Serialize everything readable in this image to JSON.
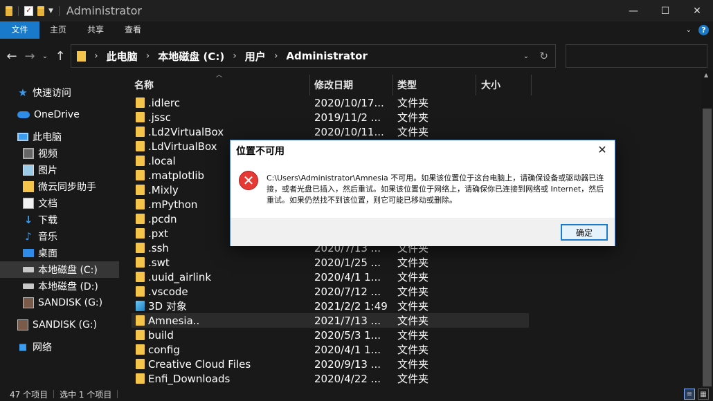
{
  "window": {
    "title": "Administrator",
    "controls": [
      "—",
      "☐",
      "✕"
    ]
  },
  "ribbon": {
    "tabs": [
      "文件",
      "主页",
      "共享",
      "查看"
    ]
  },
  "address": {
    "crumbs": [
      "此电脑",
      "本地磁盘 (C:)",
      "用户",
      "Administrator"
    ]
  },
  "nav": {
    "items": [
      {
        "label": "快速访问",
        "icon": "star-icon"
      },
      {
        "label": "OneDrive",
        "icon": "cloud-icon"
      },
      {
        "label": "此电脑",
        "icon": "pc-icon"
      },
      {
        "label": "视频",
        "icon": "video-icon"
      },
      {
        "label": "图片",
        "icon": "pictures-icon"
      },
      {
        "label": "微云同步助手",
        "icon": "weiyun-folder-icon"
      },
      {
        "label": "文档",
        "icon": "documents-icon"
      },
      {
        "label": "下载",
        "icon": "download-icon"
      },
      {
        "label": "音乐",
        "icon": "music-icon"
      },
      {
        "label": "桌面",
        "icon": "desktop-icon"
      },
      {
        "label": "本地磁盘 (C:)",
        "icon": "drive-icon"
      },
      {
        "label": "本地磁盘 (D:)",
        "icon": "drive-icon"
      },
      {
        "label": "SANDISK (G:)",
        "icon": "usb-drive-icon"
      },
      {
        "label": "SANDISK (G:)",
        "icon": "usb-drive-icon"
      },
      {
        "label": "网络",
        "icon": "network-icon"
      }
    ]
  },
  "columns": {
    "name": "名称",
    "date": "修改日期",
    "type": "类型",
    "size": "大小"
  },
  "files": [
    {
      "name": ".idlerc",
      "date": "2020/10/17...",
      "type": "文件夹"
    },
    {
      "name": ".jssc",
      "date": "2019/11/2 ...",
      "type": "文件夹"
    },
    {
      "name": ".Ld2VirtualBox",
      "date": "2020/10/11...",
      "type": "文件夹"
    },
    {
      "name": ".LdVirtualBox",
      "date": "",
      "type": ""
    },
    {
      "name": ".local",
      "date": "",
      "type": ""
    },
    {
      "name": ".matplotlib",
      "date": "",
      "type": ""
    },
    {
      "name": ".Mixly",
      "date": "",
      "type": ""
    },
    {
      "name": ".mPython",
      "date": "",
      "type": ""
    },
    {
      "name": ".pcdn",
      "date": "",
      "type": ""
    },
    {
      "name": ".pxt",
      "date": "",
      "type": ""
    },
    {
      "name": ".ssh",
      "date": "2020/7/13 ...",
      "type": "文件夹"
    },
    {
      "name": ".swt",
      "date": "2020/1/25 ...",
      "type": "文件夹"
    },
    {
      "name": ".uuid_airlink",
      "date": "2020/4/1 1...",
      "type": "文件夹"
    },
    {
      "name": ".vscode",
      "date": "2020/7/12 ...",
      "type": "文件夹"
    },
    {
      "name": "3D 对象",
      "date": "2021/2/2 1:49",
      "type": "文件夹"
    },
    {
      "name": "Amnesia..",
      "date": "2021/7/13 ...",
      "type": "文件夹"
    },
    {
      "name": "build",
      "date": "2020/5/3 1...",
      "type": "文件夹"
    },
    {
      "name": "config",
      "date": "2020/4/1 1...",
      "type": "文件夹"
    },
    {
      "name": "Creative Cloud Files",
      "date": "2020/9/13 ...",
      "type": "文件夹"
    },
    {
      "name": "Enfi_Downloads",
      "date": "2020/4/22 ...",
      "type": "文件夹"
    }
  ],
  "status": {
    "count": "47 个项目",
    "selected": "选中 1 个项目"
  },
  "dialog": {
    "title": "位置不可用",
    "message": "C:\\Users\\Administrator\\Amnesia 不可用。如果该位置位于这台电脑上，请确保设备或驱动器已连接，或者光盘已插入，然后重试。如果该位置位于网络上，请确保你已连接到网络或 Internet，然后重试。如果仍然找不到该位置，则它可能已移动或删除。",
    "ok_label": "确定",
    "close_glyph": "✕",
    "icon_glyph": "✕"
  },
  "colors": {
    "accent": "#1979ca",
    "folder": "#f4c44b",
    "error": "#e53935"
  }
}
